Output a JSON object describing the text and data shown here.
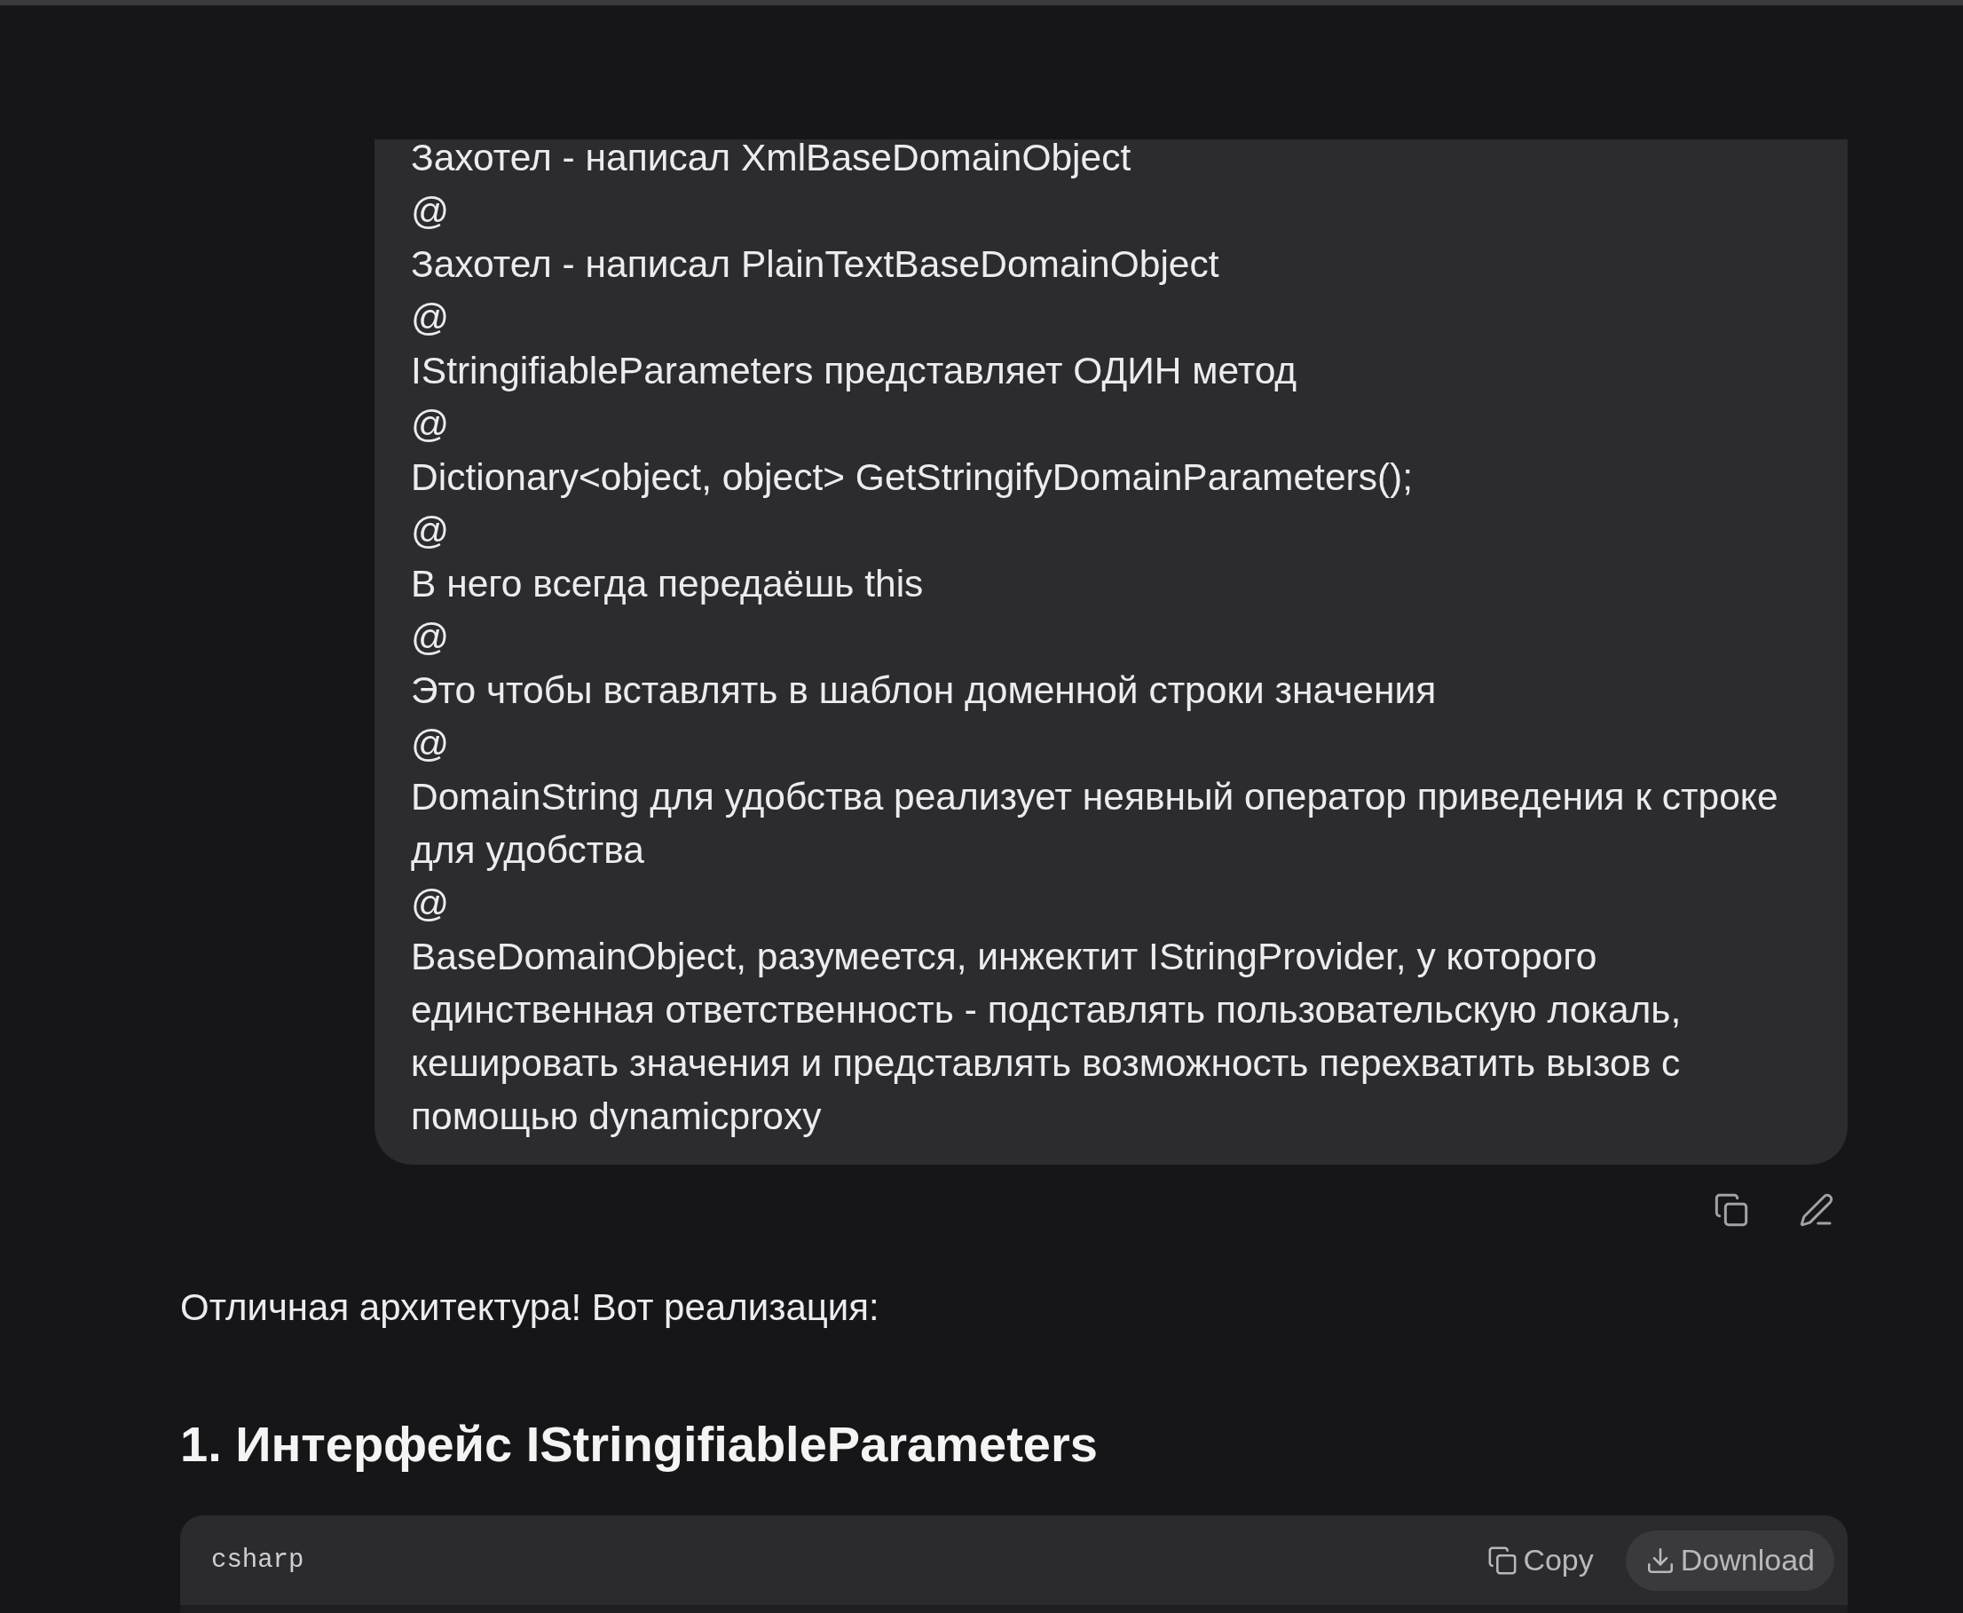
{
  "user_message": {
    "paragraphs": [
      "Захотел - написал XmlBaseDomainObject",
      "@",
      "Захотел - написал PlainTextBaseDomainObject",
      "@",
      "IStringifiableParameters представляет ОДИН метод",
      "@",
      "Dictionary<object, object> GetStringifyDomainParameters();",
      "@",
      "В него всегда передаёшь this",
      "@",
      "Это чтобы вставлять в шаблон доменной строки значения",
      "@",
      "DomainString для удобства реализует неявный оператор приведения к строке для удобства",
      "@",
      "BaseDomainObject, разумеется, инжектит IStringProvider, у которого единственная ответственность - подставлять пользовательскую локаль, кешировать значения и представлять возможность перехватить вызов с помощью dynamicproxy"
    ]
  },
  "assistant_message": {
    "intro": "Отличная архитектура! Вот реализация:",
    "heading": "1. Интерфейс IStringifiableParameters",
    "code_block": {
      "language": "csharp",
      "buttons": [
        {
          "kind": "copy",
          "label": "Copy",
          "hovered": false
        },
        {
          "kind": "download",
          "label": "Download",
          "hovered": true
        }
      ]
    }
  }
}
